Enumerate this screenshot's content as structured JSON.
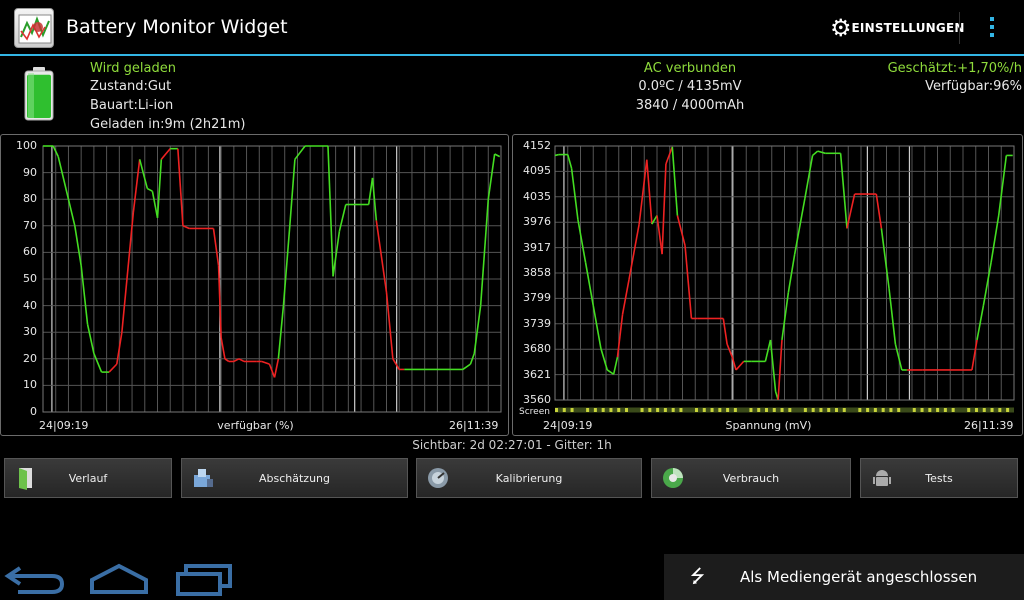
{
  "app": {
    "title": "Battery Monitor Widget",
    "icon": "app-icon"
  },
  "actionbar": {
    "settings_label": "EINSTELLUNGEN",
    "settings_icon": "gear-icon",
    "overflow_icon": "overflow-menu-icon"
  },
  "colors": {
    "accent": "#33b5e5",
    "charge_line": "#44dd22",
    "discharge_line": "#ee2222",
    "status_green": "#8fdc3c"
  },
  "status": {
    "left": {
      "state": "Wird geladen",
      "condition": "Zustand:Gut",
      "type": "Bauart:Li-ion",
      "charged_in": "Geladen in:9m (2h21m)"
    },
    "center": {
      "ac": "AC verbunden",
      "temp_voltage": "0.0ºC / 4135mV",
      "capacity": "3840 / 4000mAh"
    },
    "right": {
      "estimate": "Geschätzt:+1,70%/h",
      "available": "Verfügbar:96%"
    },
    "battery_level": 0.96
  },
  "charts": [
    {
      "y_ticks": [
        "100",
        "90",
        "80",
        "70",
        "60",
        "50",
        "40",
        "30",
        "20",
        "10",
        "0"
      ],
      "x_start": "24|09:19",
      "x_end": "26|11:39",
      "title": "verfügbar (%)",
      "points": [
        [
          0,
          100
        ],
        [
          0.8,
          100
        ],
        [
          1.2,
          96
        ],
        [
          2,
          80
        ],
        [
          2.5,
          70
        ],
        [
          3,
          55
        ],
        [
          3.5,
          33
        ],
        [
          4,
          22
        ],
        [
          4.6,
          15
        ],
        [
          5.2,
          15
        ],
        [
          5.8,
          18
        ],
        [
          6.2,
          30
        ],
        [
          7.1,
          75
        ],
        [
          7.6,
          95
        ],
        [
          8.2,
          84
        ],
        [
          8.6,
          83
        ],
        [
          9,
          73
        ],
        [
          9.3,
          95
        ],
        [
          10,
          99
        ],
        [
          10.6,
          99
        ],
        [
          11,
          70
        ],
        [
          11.5,
          69
        ],
        [
          12.5,
          69
        ],
        [
          13.4,
          69
        ],
        [
          13.8,
          55
        ],
        [
          14,
          28
        ],
        [
          14.3,
          20
        ],
        [
          14.6,
          19
        ],
        [
          15,
          19
        ],
        [
          15.4,
          20
        ],
        [
          15.8,
          19
        ],
        [
          16.8,
          19
        ],
        [
          17.2,
          19
        ],
        [
          17.8,
          18
        ],
        [
          18.2,
          13
        ],
        [
          18.5,
          20
        ],
        [
          18.9,
          40
        ],
        [
          19.4,
          70
        ],
        [
          19.8,
          95
        ],
        [
          20.6,
          100
        ],
        [
          22.4,
          100
        ],
        [
          22.8,
          51
        ],
        [
          23.3,
          68
        ],
        [
          23.8,
          78
        ],
        [
          25,
          78
        ],
        [
          25.6,
          78
        ],
        [
          25.9,
          88
        ],
        [
          26.2,
          72
        ],
        [
          27,
          45
        ],
        [
          27.5,
          20
        ],
        [
          28,
          16
        ],
        [
          28.4,
          16
        ],
        [
          30,
          16
        ],
        [
          32,
          16
        ],
        [
          33,
          16
        ],
        [
          33.6,
          18
        ],
        [
          33.9,
          22
        ],
        [
          34.4,
          40
        ],
        [
          35,
          80
        ],
        [
          35.5,
          97
        ],
        [
          35.9,
          96
        ]
      ],
      "color_split": [
        [
          0.6,
          "#44dd22"
        ],
        [
          4.7,
          "#ee2222"
        ],
        [
          7.5,
          "#44dd22"
        ],
        [
          9.1,
          "#ee2222"
        ],
        [
          9.4,
          "#44dd22"
        ],
        [
          10.5,
          "#ee2222"
        ],
        [
          18.3,
          "#ee2222"
        ],
        [
          18.4,
          "#44dd22"
        ],
        [
          22.5,
          "#44dd22"
        ],
        [
          25.7,
          "#44dd22"
        ],
        [
          26,
          "#ee2222"
        ],
        [
          28.4,
          "#44dd22"
        ]
      ]
    },
    {
      "y_ticks": [
        "4152",
        "4095",
        "4035",
        "3976",
        "3917",
        "3858",
        "3799",
        "3739",
        "3680",
        "3621",
        "3560"
      ],
      "x_start": "24|09:19",
      "x_end": "26|11:39",
      "title": "Spannung (mV)",
      "screen_label": "Screen",
      "points": [
        [
          0,
          4130
        ],
        [
          0.3,
          4132
        ],
        [
          1,
          4132
        ],
        [
          1.3,
          4100
        ],
        [
          1.8,
          3980
        ],
        [
          2.4,
          3880
        ],
        [
          3,
          3780
        ],
        [
          3.6,
          3680
        ],
        [
          4.1,
          3630
        ],
        [
          4.6,
          3620
        ],
        [
          4.9,
          3660
        ],
        [
          5.3,
          3760
        ],
        [
          5.8,
          3840
        ],
        [
          6.6,
          3970
        ],
        [
          7.2,
          4120
        ],
        [
          7.6,
          3970
        ],
        [
          8,
          3990
        ],
        [
          8.4,
          3900
        ],
        [
          8.7,
          4110
        ],
        [
          9.2,
          4150
        ],
        [
          9.6,
          3990
        ],
        [
          10.2,
          3920
        ],
        [
          10.7,
          3750
        ],
        [
          11.2,
          3750
        ],
        [
          12,
          3750
        ],
        [
          13.2,
          3750
        ],
        [
          13.5,
          3690
        ],
        [
          13.9,
          3660
        ],
        [
          14.2,
          3630
        ],
        [
          14.8,
          3650
        ],
        [
          15.4,
          3650
        ],
        [
          16.5,
          3650
        ],
        [
          16.9,
          3700
        ],
        [
          17.3,
          3580
        ],
        [
          17.5,
          3560
        ],
        [
          17.8,
          3700
        ],
        [
          18.3,
          3810
        ],
        [
          18.8,
          3900
        ],
        [
          19.6,
          4030
        ],
        [
          20.2,
          4130
        ],
        [
          20.6,
          4140
        ],
        [
          21.2,
          4135
        ],
        [
          22.4,
          4135
        ],
        [
          22.9,
          3960
        ],
        [
          23.5,
          4040
        ],
        [
          24.4,
          4040
        ],
        [
          25.2,
          4040
        ],
        [
          25.6,
          3960
        ],
        [
          26.2,
          3820
        ],
        [
          26.7,
          3690
        ],
        [
          27.2,
          3630
        ],
        [
          27.6,
          3630
        ],
        [
          28.8,
          3630
        ],
        [
          31,
          3630
        ],
        [
          32,
          3630
        ],
        [
          32.7,
          3630
        ],
        [
          33.1,
          3700
        ],
        [
          33.6,
          3780
        ],
        [
          34.2,
          3880
        ],
        [
          34.8,
          3990
        ],
        [
          35.4,
          4130
        ],
        [
          35.9,
          4130
        ]
      ],
      "color_split": [
        [
          1,
          "#44dd22"
        ],
        [
          4.8,
          "#ee2222"
        ],
        [
          7.3,
          "#44dd22"
        ],
        [
          7.7,
          "#ee2222"
        ],
        [
          9.2,
          "#44dd22"
        ],
        [
          9.3,
          "#ee2222"
        ],
        [
          14.2,
          "#ee2222"
        ],
        [
          14.3,
          "#44dd22"
        ],
        [
          17.5,
          "#ee2222"
        ],
        [
          17.6,
          "#44dd22"
        ],
        [
          22.5,
          "#44dd22"
        ],
        [
          22.6,
          "#ee2222"
        ],
        [
          23,
          "#ee2222"
        ],
        [
          25.3,
          "#44dd22"
        ],
        [
          27.3,
          "#ee2222"
        ],
        [
          32.8,
          "#44dd22"
        ]
      ]
    }
  ],
  "visible_info": "Sichtbar: 2d 02:27:01 - Gitter: 1h",
  "buttons": [
    {
      "label": "Verlauf",
      "icon": "history-door-icon"
    },
    {
      "label": "Abschätzung",
      "icon": "estimate-icon"
    },
    {
      "label": "Kalibrierung",
      "icon": "calibration-icon"
    },
    {
      "label": "Verbrauch",
      "icon": "usage-icon"
    },
    {
      "label": "Tests",
      "icon": "android-test-icon"
    }
  ],
  "notification": {
    "text": "Als Mediengerät angeschlossen",
    "icon": "usb-icon"
  },
  "system_nav": {
    "back_icon": "back-icon",
    "home_icon": "home-icon",
    "recents_icon": "recents-icon"
  }
}
